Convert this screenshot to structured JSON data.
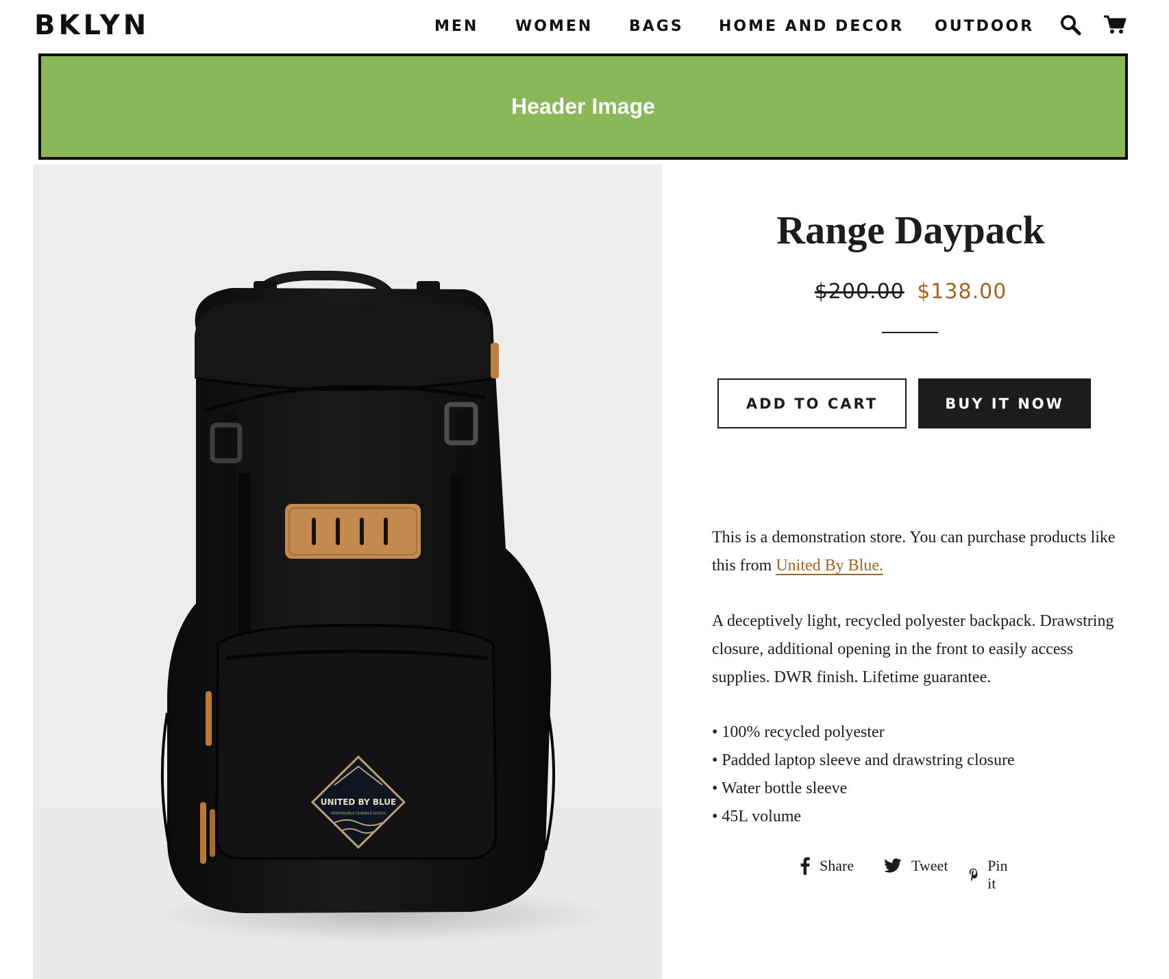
{
  "header": {
    "logo": "BKLYN",
    "nav": [
      "MEN",
      "WOMEN",
      "BAGS",
      "HOME AND DECOR",
      "OUTDOOR"
    ],
    "icons": [
      "search-icon",
      "cart-icon"
    ]
  },
  "banner": {
    "text": "Header Image",
    "color": "#8ab858"
  },
  "product": {
    "title": "Range Daypack",
    "price_old": "$200.00",
    "price_new": "$138.00",
    "accent_color": "#9e6526",
    "add_to_cart": "ADD TO CART",
    "buy_now": "BUY IT NOW",
    "image": {
      "patch_text": "UNITED BY BLUE",
      "patch_subtext": "RESPONSIBLE DURABLE GOODS"
    },
    "description": {
      "intro_before": "This is a demonstration store. You can purchase products like this from ",
      "intro_link": "United By Blue.",
      "body": "A deceptively light, recycled polyester backpack. Drawstring closure, additional opening in the front to easily access supplies. DWR finish. Lifetime guarantee.",
      "bullets": [
        "• 100% recycled polyester",
        "• Padded laptop sleeve and drawstring closure",
        "• Water bottle sleeve",
        "• 45L volume"
      ]
    },
    "share": [
      "Share",
      "Tweet",
      "Pin it"
    ]
  }
}
